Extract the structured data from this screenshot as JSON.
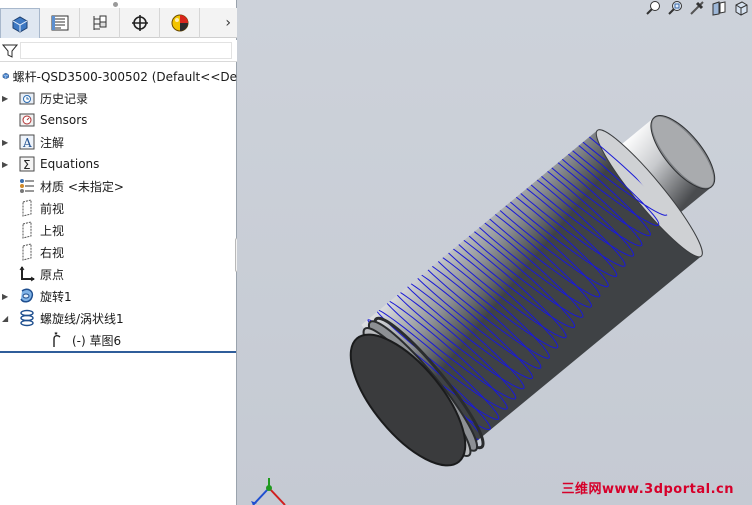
{
  "panel": {
    "tabs": [
      {
        "name": "feature-manager",
        "active": true
      },
      {
        "name": "property-manager",
        "active": false
      },
      {
        "name": "configuration-manager",
        "active": false
      },
      {
        "name": "dimxpert-manager",
        "active": false
      },
      {
        "name": "display-manager",
        "active": false
      }
    ],
    "more_symbol": "›",
    "filter_placeholder": "",
    "root": "螺杆-QSD3500-300502  (Default<<De",
    "items": [
      {
        "label": "历史记录",
        "icon": "history-folder-icon",
        "expandable": true
      },
      {
        "label": "Sensors",
        "icon": "sensor-icon",
        "expandable": false
      },
      {
        "label": "注解",
        "icon": "annotation-icon",
        "expandable": true
      },
      {
        "label": "Equations",
        "icon": "equations-icon",
        "expandable": true
      },
      {
        "label": "材质 <未指定>",
        "icon": "material-icon",
        "expandable": false
      },
      {
        "label": "前视",
        "icon": "plane-icon",
        "expandable": false
      },
      {
        "label": "上视",
        "icon": "plane-icon",
        "expandable": false
      },
      {
        "label": "右视",
        "icon": "plane-icon",
        "expandable": false
      },
      {
        "label": "原点",
        "icon": "origin-icon",
        "expandable": false
      },
      {
        "label": "旋转1",
        "icon": "revolve-icon",
        "expandable": true
      },
      {
        "label": "螺旋线/涡状线1",
        "icon": "helix-icon",
        "expandable": true,
        "expanded": true
      },
      {
        "label": "(-) 草图6",
        "icon": "sketch-icon",
        "expandable": false,
        "child": true
      }
    ]
  },
  "viewport": {
    "watermark": "三维网www.3dportal.cn",
    "hud_icons": [
      "zoom-to-fit-icon",
      "zoom-area-icon",
      "previous-view-icon",
      "section-view-icon",
      "view-orientation-icon"
    ]
  },
  "colors": {
    "helix": "#1a1ad6",
    "active_line": "#2f5d9a",
    "watermark": "#d6002a"
  }
}
